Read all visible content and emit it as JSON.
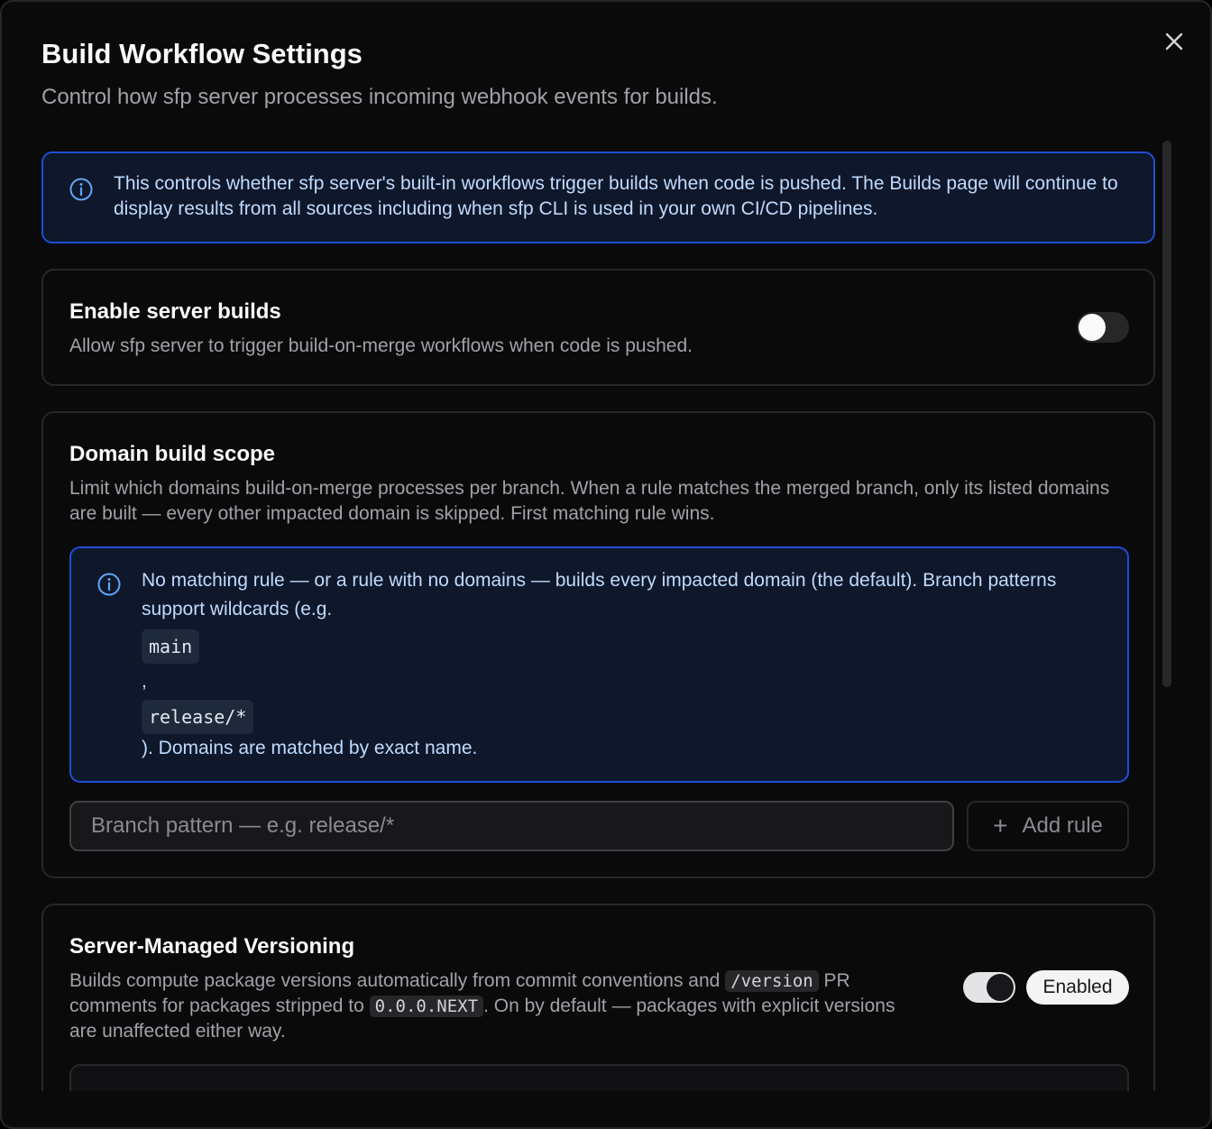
{
  "dialog": {
    "title": "Build Workflow Settings",
    "subtitle": "Control how sfp server processes incoming webhook events for builds."
  },
  "info_banner": {
    "icon": "info-icon",
    "text": "This controls whether sfp server's built-in workflows trigger builds when code is pushed. The Builds page will continue to display results from all sources including when sfp CLI is used in your own CI/CD pipelines."
  },
  "server_builds": {
    "title": "Enable server builds",
    "description": "Allow sfp server to trigger build-on-merge workflows when code is pushed.",
    "enabled": false
  },
  "domain_scope": {
    "title": "Domain build scope",
    "description": "Limit which domains build-on-merge processes per branch. When a rule matches the merged branch, only its listed domains are built — every other impacted domain is skipped. First matching rule wins.",
    "info": {
      "line1": "No matching rule — or a rule with no domains — builds every impacted domain (the default). Branch patterns support wildcards (e.g.",
      "code1": "main",
      "comma": ",",
      "code2": "release/*",
      "line_end": "). Domains are matched by exact name."
    },
    "branch_input": {
      "value": "",
      "placeholder": "Branch pattern — e.g. release/*"
    },
    "add_rule_label": "Add rule"
  },
  "versioning": {
    "title": "Server-Managed Versioning",
    "desc_part1": "Builds compute package versions automatically from commit conventions and",
    "code_version": "/version",
    "desc_part2": "PR comments for packages stripped to",
    "code_next": "0.0.0.NEXT",
    "desc_part3": ". On by default — packages with explicit versions are unaffected either way.",
    "enabled": true,
    "badge": "Enabled"
  },
  "colors": {
    "accent_blue": "#1d4ed8",
    "info_text": "#bfdbfe"
  }
}
